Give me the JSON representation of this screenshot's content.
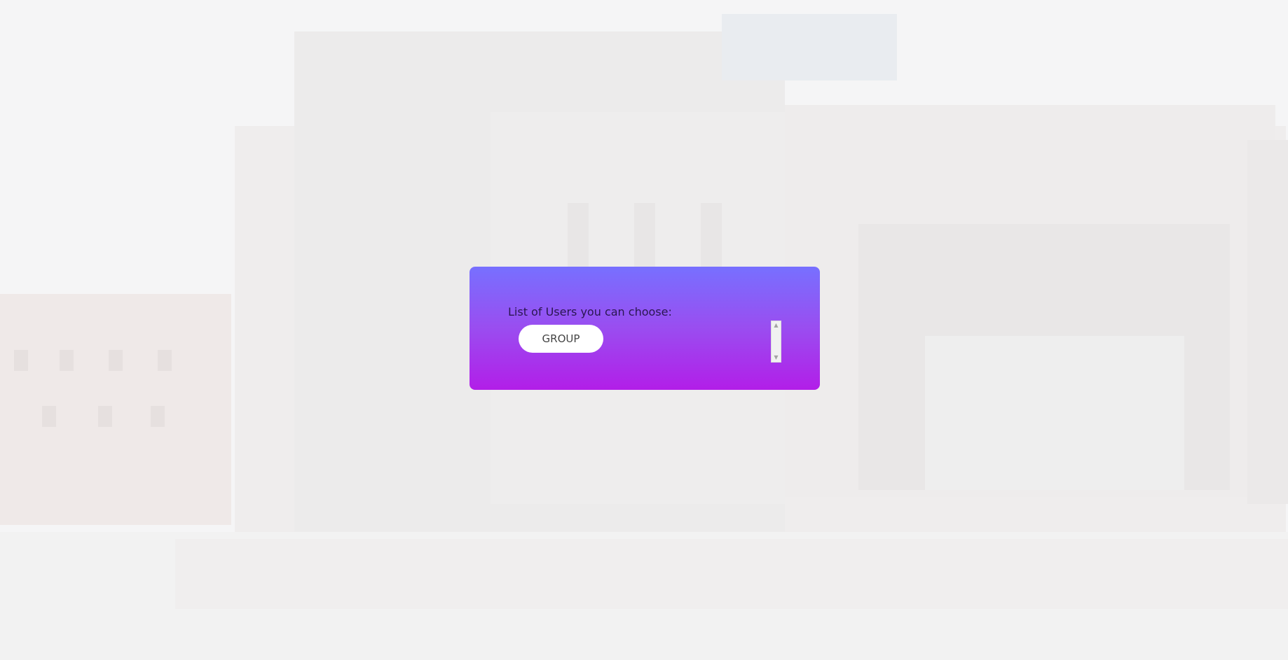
{
  "dialog": {
    "label": "List of Users you can choose:",
    "group_button": "GROUP"
  },
  "scrollbar": {
    "up_arrow": "▲",
    "down_arrow": "▼"
  },
  "colors": {
    "card_gradient_top": "#7770ff",
    "card_gradient_bottom": "#b21ee8",
    "button_bg": "#ffffff"
  }
}
